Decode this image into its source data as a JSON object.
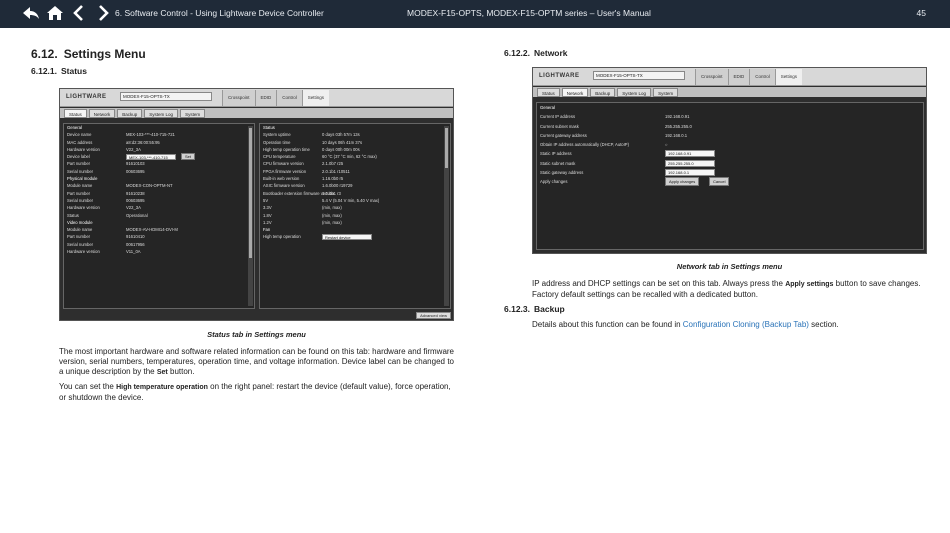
{
  "header": {
    "chapter": "6. Software Control - Using Lightware Device Controller",
    "manual": "MODEX-F15-OPTS, MODEX-F15-OPTM series – User's Manual",
    "page": "45",
    "nav_icons": [
      "double-back-arrow-icon",
      "home-icon",
      "chevron-left-icon",
      "chevron-right-icon"
    ]
  },
  "left": {
    "h1_num": "6.12.",
    "h1_title": "Settings Menu",
    "h2_num": "6.12.1.",
    "h2_title": "Status",
    "caption": "Status tab in Settings menu",
    "p1_a": "The most important hardware and software related information can be found on this tab: hardware and firmware version, serial numbers, temperatures, operation time, and voltage information. Device label can be changed to a unique description by the",
    "p1_bold": "Set",
    "p1_b": "button.",
    "p2_a": "You can set the",
    "p2_bold": "High temperature operation",
    "p2_b": "on the right panel: restart the device (default value), force operation, or shutdown the device."
  },
  "right": {
    "h2_num": "6.12.2.",
    "h2_title": "Network",
    "caption": "Network tab in Settings menu",
    "p1_a": "IP address and DHCP settings can be set on this tab. Always press the",
    "p1_bold": "Apply settings",
    "p1_b": "button to save changes. Factory default settings can be recalled with a dedicated button.",
    "h3_num": "6.12.3.",
    "h3_title": "Backup",
    "p2_a": "Details about this function can be found in",
    "p2_link": "Configuration Cloning (Backup Tab)",
    "p2_b": "section."
  },
  "status_shot": {
    "logo": "LIGHTWARE",
    "device": "MODEX-F15-OPTS-TX",
    "top_tabs": [
      "Crosspoint",
      "EDID",
      "Control",
      "Settings"
    ],
    "sub_tabs": [
      "Status",
      "Network",
      "Backup",
      "System Log",
      "System"
    ],
    "left_rows": [
      {
        "k": "General",
        "v": ""
      },
      {
        "k": "Device name",
        "v": "MEX-103-***-410-715-721"
      },
      {
        "k": "MAC address",
        "v": "a8:d2:36:00:55:95"
      },
      {
        "k": "Hardware version",
        "v": "V22_3A"
      },
      {
        "k": "Device label",
        "v": "MEX-103-***-410-715",
        "btn": "Set"
      },
      {
        "k": "Part number",
        "v": "91610103"
      },
      {
        "k": "Serial number",
        "v": "00603695"
      },
      {
        "k": "Physical module",
        "v": ""
      },
      {
        "k": "Module name",
        "v": "MODEX-CON-OPTM-NT"
      },
      {
        "k": "Part number",
        "v": "91610238"
      },
      {
        "k": "Serial number",
        "v": "00603695"
      },
      {
        "k": "Hardware version",
        "v": "V22_3A"
      },
      {
        "k": "Status",
        "v": "Operational"
      },
      {
        "k": "Video module",
        "v": ""
      },
      {
        "k": "Module name",
        "v": "MODEX-AV-HDMI14-DVI-M"
      },
      {
        "k": "Part number",
        "v": "91610410"
      },
      {
        "k": "Serial number",
        "v": "00617956"
      },
      {
        "k": "Hardware version",
        "v": "V11_0A"
      }
    ],
    "right_rows": [
      {
        "k": "Status",
        "v": ""
      },
      {
        "k": "System uptime",
        "v": "0 days 03h 57m 13s"
      },
      {
        "k": "Operation time",
        "v": "10 days 06h 41m 37s"
      },
      {
        "k": "High temp operation time",
        "v": "0 days 00h 00m 00s"
      },
      {
        "k": "CPU temperature",
        "v": "60 °C (37 °C min, 62 °C max)"
      },
      {
        "k": "CPU firmware version",
        "v": "2.1.0b7 r25"
      },
      {
        "k": "FPGA firmware version",
        "v": "2.0.1b1 r10511"
      },
      {
        "k": "Built-in web version",
        "v": "1.16.0b0 r5"
      },
      {
        "k": "ASIC firmware version",
        "v": "1.6.0b00 r19729"
      },
      {
        "k": "Bootloader extension firmware version",
        "v": "1.1.0b1 r3"
      },
      {
        "k": "5V",
        "v": "5.4 V (5.04 V min, 5.40 V max)"
      },
      {
        "k": "3.3V",
        "v": "(min, max)"
      },
      {
        "k": "1.8V",
        "v": "(min, max)"
      },
      {
        "k": "1.2V",
        "v": "(min, max)"
      },
      {
        "k": "Fan",
        "v": ""
      },
      {
        "k": "High temp operation",
        "v": "",
        "box": "Restart device"
      }
    ],
    "advanced": "Advanced view"
  },
  "network_shot": {
    "device": "MODEX-F15-OPTS-TX",
    "top_tabs": [
      "Crosspoint",
      "EDID",
      "Control",
      "Settings"
    ],
    "sub_tabs": [
      "Status",
      "Network",
      "Backup",
      "System Log",
      "System"
    ],
    "rows": [
      {
        "k": "General",
        "v": ""
      },
      {
        "k": "Current IP address",
        "v": "192.168.0.91"
      },
      {
        "k": "Current subnet mask",
        "v": "255.255.255.0"
      },
      {
        "k": "Current gateway address",
        "v": "192.168.0.1"
      },
      {
        "k": "Obtain IP address automatically (DHCP, AutoIP)",
        "v": "○"
      },
      {
        "k": "Static IP address",
        "v": "",
        "box": "192.168.0.91"
      },
      {
        "k": "Static subnet mask",
        "v": "",
        "box": "255.255.255.0"
      },
      {
        "k": "Static gateway address",
        "v": "",
        "box": "192.168.0.1"
      },
      {
        "k": "Apply changes",
        "v": "",
        "btn": "Apply changes",
        "btn2": "Cancel"
      }
    ]
  }
}
